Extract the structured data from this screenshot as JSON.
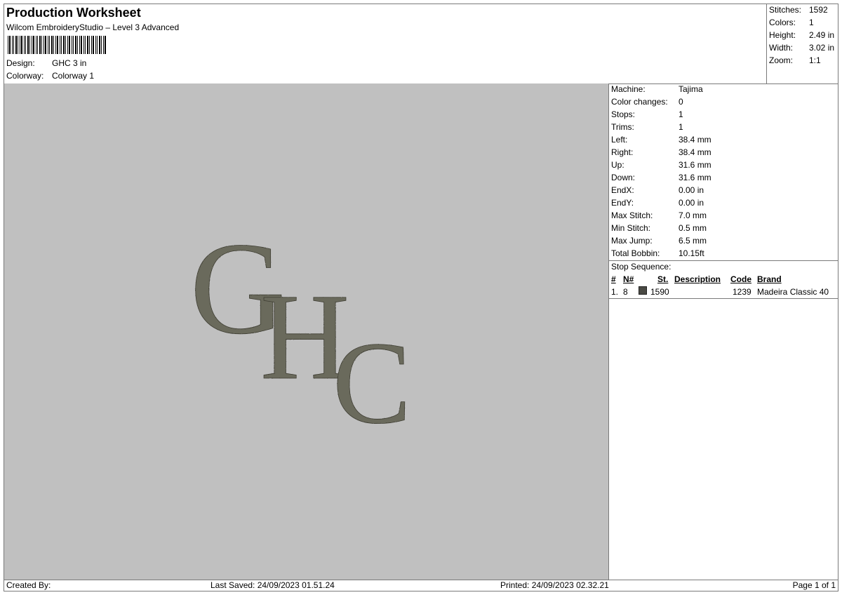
{
  "header": {
    "title": "Production Worksheet",
    "subtitle": "Wilcom EmbroideryStudio – Level 3 Advanced",
    "design_label": "Design:",
    "design_value": "GHC 3 in",
    "colorway_label": "Colorway:",
    "colorway_value": "Colorway 1"
  },
  "stats": [
    {
      "label": "Stitches:",
      "value": "1592"
    },
    {
      "label": "Colors:",
      "value": "1"
    },
    {
      "label": "Height:",
      "value": "2.49 in"
    },
    {
      "label": "Width:",
      "value": "3.02 in"
    },
    {
      "label": "Zoom:",
      "value": "1:1"
    }
  ],
  "design_preview": {
    "letters": [
      "G",
      "H",
      "C"
    ],
    "thread_color": "#6b6a5c"
  },
  "machine_info": [
    {
      "label": "Machine:",
      "value": "Tajima"
    },
    {
      "label": "Color changes:",
      "value": "0"
    },
    {
      "label": "Stops:",
      "value": "1"
    },
    {
      "label": "Trims:",
      "value": "1"
    },
    {
      "label": "Left:",
      "value": "38.4 mm"
    },
    {
      "label": "Right:",
      "value": "38.4 mm"
    },
    {
      "label": "Up:",
      "value": "31.6 mm"
    },
    {
      "label": "Down:",
      "value": "31.6 mm"
    },
    {
      "label": "EndX:",
      "value": "0.00 in"
    },
    {
      "label": "EndY:",
      "value": "0.00 in"
    },
    {
      "label": "Max Stitch:",
      "value": "7.0 mm"
    },
    {
      "label": "Min Stitch:",
      "value": "0.5 mm"
    },
    {
      "label": "Max Jump:",
      "value": "6.5 mm"
    },
    {
      "label": "Total Bobbin:",
      "value": "10.15ft"
    }
  ],
  "stop_sequence": {
    "title": "Stop Sequence:",
    "columns": [
      "#",
      "N#",
      "St.",
      "Description",
      "Code",
      "Brand"
    ],
    "rows": [
      {
        "num": "1.",
        "n": "8",
        "swatch_color": "#4a4a44",
        "stitches": "1590",
        "description": "",
        "code": "1239",
        "brand": "Madeira Classic 40"
      }
    ]
  },
  "footer": {
    "created_by": "Created By:",
    "last_saved": "Last Saved: 24/09/2023 01.51.24",
    "printed": "Printed: 24/09/2023 02.32.21",
    "page": "Page 1 of 1"
  }
}
